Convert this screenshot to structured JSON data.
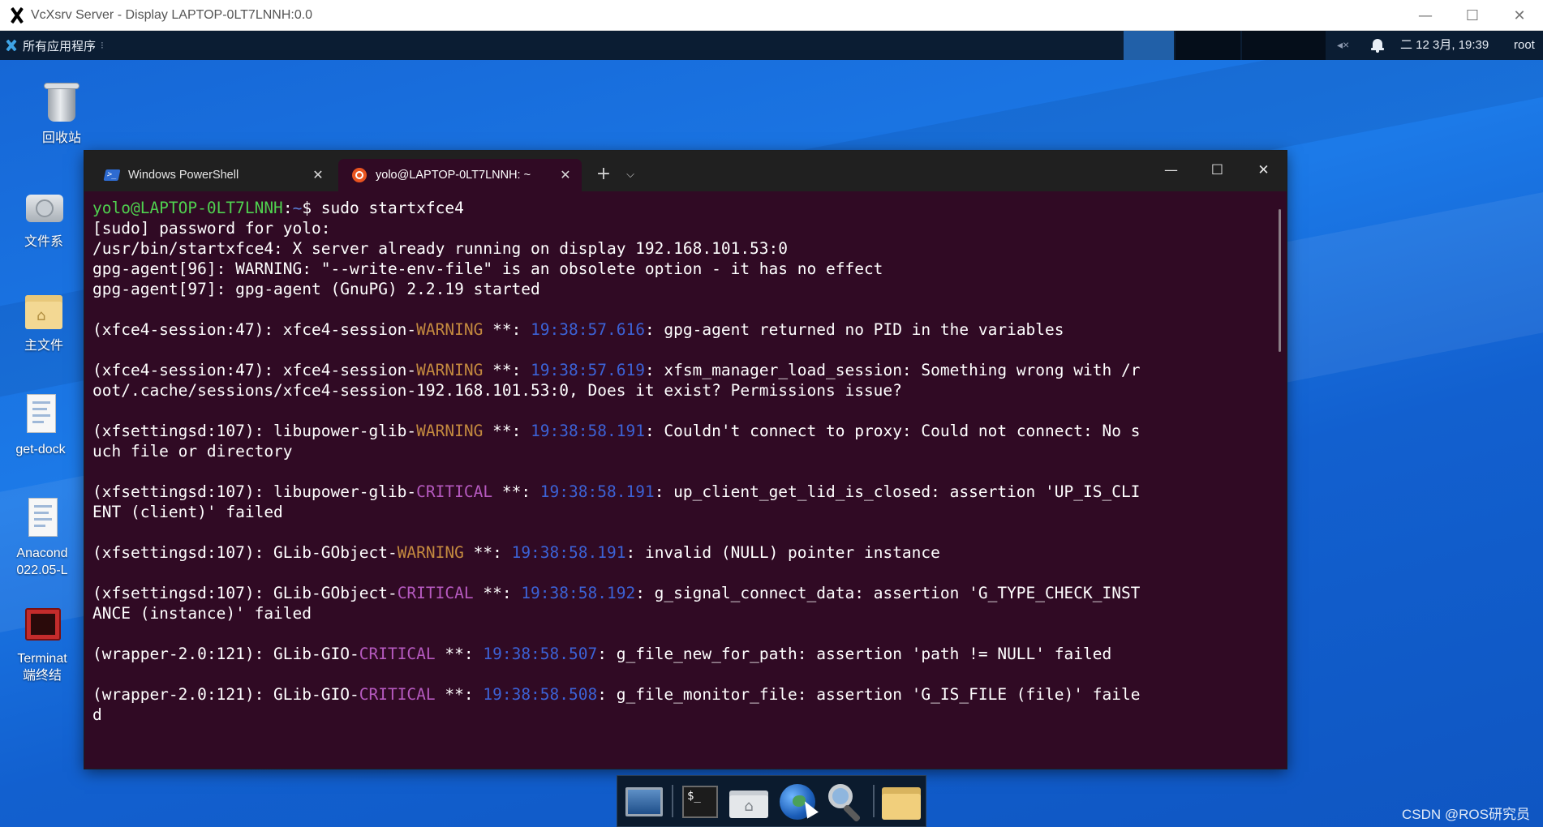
{
  "host_window": {
    "title": "VcXsrv Server - Display LAPTOP-0LT7LNNH:0.0",
    "controls": {
      "minimize": "—",
      "maximize": "☐",
      "close": "✕"
    }
  },
  "panel": {
    "apps_menu_label": "所有应用程序",
    "apps_menu_handle": "⁝",
    "volume_icon": "◂×",
    "clock": "二 12 3月, 19:39",
    "user": "root",
    "colors": {
      "background": "#0b1d33",
      "active_workspace": "#2160a8"
    }
  },
  "desktop": {
    "icons": [
      {
        "label": "回收站",
        "icon": "trash-icon"
      },
      {
        "label": "文件系",
        "icon": "drive-icon"
      },
      {
        "label": "主文件",
        "icon": "home-folder-icon"
      },
      {
        "label": "get-dock",
        "icon": "document-icon"
      },
      {
        "label": "Anacond\n022.05-L",
        "icon": "document-icon"
      },
      {
        "label": "Terminat\n端终结",
        "icon": "terminal-app-icon"
      }
    ]
  },
  "terminal": {
    "tabs": [
      {
        "label": "Windows PowerShell",
        "icon": "powershell-icon",
        "close": "✕",
        "active": false
      },
      {
        "label": "yolo@LAPTOP-0LT7LNNH: ~",
        "icon": "ubuntu-icon",
        "close": "✕",
        "active": true
      }
    ],
    "new_tab": "+",
    "tab_dropdown": "⌵",
    "controls": {
      "minimize": "—",
      "maximize": "☐",
      "close": "✕"
    },
    "colors": {
      "background": "#300a24",
      "tabbar": "#202020",
      "user": "#4fd14f",
      "warning": "#c48a3f",
      "critical": "#b65ac0",
      "timestamp": "#3c62d6"
    },
    "lines": [
      {
        "segments": [
          {
            "t": "yolo@LAPTOP-0LT7LNNH",
            "c": "user"
          },
          {
            "t": ":"
          },
          {
            "t": "~",
            "c": "path"
          },
          {
            "t": "$ sudo startxfce4"
          }
        ]
      },
      {
        "segments": [
          {
            "t": "[sudo] password for yolo:"
          }
        ]
      },
      {
        "segments": [
          {
            "t": "/usr/bin/startxfce4: X server already running on display 192.168.101.53:0"
          }
        ]
      },
      {
        "segments": [
          {
            "t": "gpg-agent[96]: WARNING: \"--write-env-file\" is an obsolete option - it has no effect"
          }
        ]
      },
      {
        "segments": [
          {
            "t": "gpg-agent[97]: gpg-agent (GnuPG) 2.2.19 started"
          }
        ]
      },
      {
        "segments": []
      },
      {
        "segments": [
          {
            "t": "(xfce4-session:47): xfce4-session-"
          },
          {
            "t": "WARNING",
            "c": "warn"
          },
          {
            "t": " **: "
          },
          {
            "t": "19:38:57.616",
            "c": "time"
          },
          {
            "t": ": gpg-agent returned no PID in the variables"
          }
        ]
      },
      {
        "segments": []
      },
      {
        "segments": [
          {
            "t": "(xfce4-session:47): xfce4-session-"
          },
          {
            "t": "WARNING",
            "c": "warn"
          },
          {
            "t": " **: "
          },
          {
            "t": "19:38:57.619",
            "c": "time"
          },
          {
            "t": ": xfsm_manager_load_session: Something wrong with /r"
          }
        ]
      },
      {
        "segments": [
          {
            "t": "oot/.cache/sessions/xfce4-session-192.168.101.53:0, Does it exist? Permissions issue?"
          }
        ]
      },
      {
        "segments": []
      },
      {
        "segments": [
          {
            "t": "(xfsettingsd:107): libupower-glib-"
          },
          {
            "t": "WARNING",
            "c": "warn"
          },
          {
            "t": " **: "
          },
          {
            "t": "19:38:58.191",
            "c": "time"
          },
          {
            "t": ": Couldn't connect to proxy: Could not connect: No s"
          }
        ]
      },
      {
        "segments": [
          {
            "t": "uch file or directory"
          }
        ]
      },
      {
        "segments": []
      },
      {
        "segments": [
          {
            "t": "(xfsettingsd:107): libupower-glib-"
          },
          {
            "t": "CRITICAL",
            "c": "crit"
          },
          {
            "t": " **: "
          },
          {
            "t": "19:38:58.191",
            "c": "time"
          },
          {
            "t": ": up_client_get_lid_is_closed: assertion 'UP_IS_CLI"
          }
        ]
      },
      {
        "segments": [
          {
            "t": "ENT (client)' failed"
          }
        ]
      },
      {
        "segments": []
      },
      {
        "segments": [
          {
            "t": "(xfsettingsd:107): GLib-GObject-"
          },
          {
            "t": "WARNING",
            "c": "warn"
          },
          {
            "t": " **: "
          },
          {
            "t": "19:38:58.191",
            "c": "time"
          },
          {
            "t": ": invalid (NULL) pointer instance"
          }
        ]
      },
      {
        "segments": []
      },
      {
        "segments": [
          {
            "t": "(xfsettingsd:107): GLib-GObject-"
          },
          {
            "t": "CRITICAL",
            "c": "crit"
          },
          {
            "t": " **: "
          },
          {
            "t": "19:38:58.192",
            "c": "time"
          },
          {
            "t": ": g_signal_connect_data: assertion 'G_TYPE_CHECK_INST"
          }
        ]
      },
      {
        "segments": [
          {
            "t": "ANCE (instance)' failed"
          }
        ]
      },
      {
        "segments": []
      },
      {
        "segments": [
          {
            "t": "(wrapper-2.0:121): GLib-GIO-"
          },
          {
            "t": "CRITICAL",
            "c": "crit"
          },
          {
            "t": " **: "
          },
          {
            "t": "19:38:58.507",
            "c": "time"
          },
          {
            "t": ": g_file_new_for_path: assertion 'path != NULL' failed"
          }
        ]
      },
      {
        "segments": []
      },
      {
        "segments": [
          {
            "t": "(wrapper-2.0:121): GLib-GIO-"
          },
          {
            "t": "CRITICAL",
            "c": "crit"
          },
          {
            "t": " **: "
          },
          {
            "t": "19:38:58.508",
            "c": "time"
          },
          {
            "t": ": g_file_monitor_file: assertion 'G_IS_FILE (file)' faile"
          }
        ]
      },
      {
        "segments": [
          {
            "t": "d"
          }
        ]
      }
    ]
  },
  "dock": {
    "items": [
      {
        "name": "show-desktop",
        "icon": "show-desktop-icon"
      },
      {
        "name": "terminal",
        "icon": "terminal-icon",
        "glyph": "$_"
      },
      {
        "name": "file-manager",
        "icon": "home-folder-icon"
      },
      {
        "name": "web-browser",
        "icon": "globe-icon"
      },
      {
        "name": "app-finder",
        "icon": "magnifier-icon"
      },
      {
        "name": "folder",
        "icon": "folder-icon"
      }
    ]
  },
  "watermark": "CSDN @ROS研究员"
}
